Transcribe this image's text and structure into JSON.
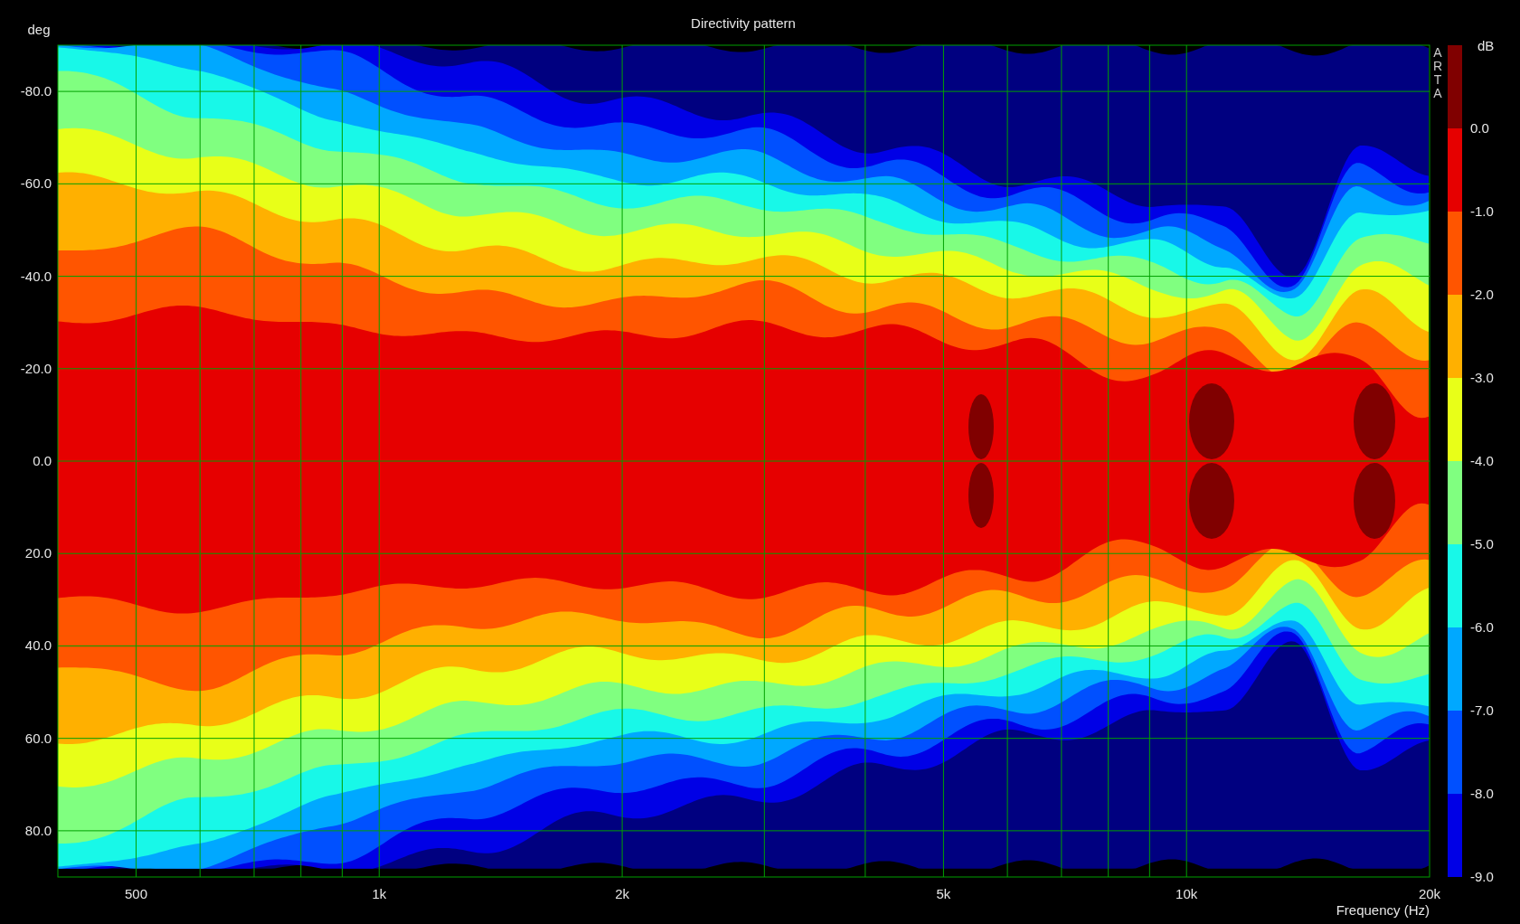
{
  "title": "Directivity pattern",
  "y_axis": {
    "label": "deg",
    "ticks": [
      "-80.0",
      "-60.0",
      "-40.0",
      "-20.0",
      "0.0",
      "20.0",
      "40.0",
      "60.0",
      "80.0"
    ]
  },
  "x_axis": {
    "label": "Frequency (Hz)",
    "ticks": [
      "500",
      "1k",
      "2k",
      "5k",
      "10k",
      "20k"
    ]
  },
  "colorbar": {
    "unit": "dB",
    "labels": [
      "0.0",
      "-1.0",
      "-2.0",
      "-3.0",
      "-4.0",
      "-5.0",
      "-6.0",
      "-7.0",
      "-8.0",
      "-9.0"
    ]
  },
  "brand": "ARTA"
}
